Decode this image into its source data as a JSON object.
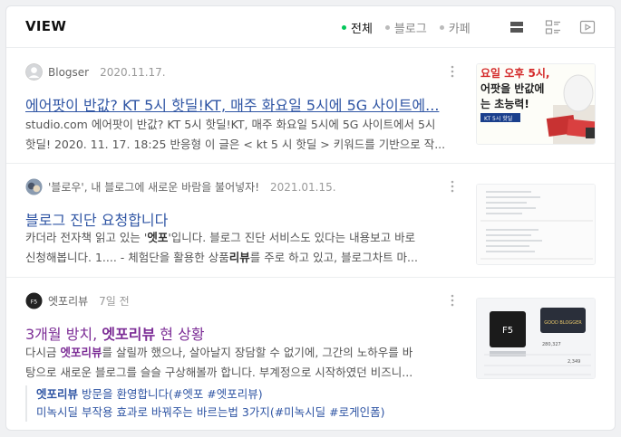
{
  "header": {
    "title": "VIEW",
    "tabs": [
      {
        "label": "전체",
        "active": true
      },
      {
        "label": "블로그",
        "active": false
      },
      {
        "label": "카페",
        "active": false
      }
    ]
  },
  "results": [
    {
      "source": "Blogser",
      "date": "2020.11.17.",
      "title": "에어팟이 반값? KT 5시 핫딜!KT, 매주 화요일 5시에 5G 사이트에...",
      "desc_line1": "studio.com 에어팟이 반값? KT 5시 핫딜!KT, 매주 화요일 5시에 5G 사이트에서 5시",
      "desc_line2": "핫딜! 2020. 11. 17. 18:25 반응형 이 글은 < kt 5 시 핫딜 > 키워드를 기반으로 작...",
      "thumb": {
        "line1": "요일 오후 5시,",
        "line2": "어팟을 반값에",
        "line3": "는 초능력!",
        "badge": "KT 5시 핫딜"
      }
    },
    {
      "source": "'블로우', 내 블로그에 새로운 바람을 불어넣자!",
      "date": "2021.01.15.",
      "title": "블로그 진단 요청합니다",
      "desc_line1_pre": "카더라 전자책 읽고 있는 '",
      "desc_line1_hl": "엣포",
      "desc_line1_post": "'입니다. 블로그 진단 서비스도 있다는 내용보고 바로",
      "desc_line2_pre": "신청해봅니다. 1.... - 체험단을 활용한 상품",
      "desc_line2_hl": "리뷰",
      "desc_line2_post": "를 주로 하고 있고, 블로그차트 마..."
    },
    {
      "source": "엣포리뷰",
      "date": "7일 전",
      "title_pre": "3개월 방치, ",
      "title_hl": "엣포리뷰",
      "title_post": " 현 상황",
      "desc_line1_pre": "다시금 ",
      "desc_line1_hl": "엣포리뷰",
      "desc_line1_post": "를 살릴까 했으나, 살아날지 장담할 수 없기에, 그간의 노하우를 바",
      "desc_line2": "탕으로 새로운 블로그를 슬슬 구상해볼까 합니다. 부계정으로 시작하였던 비즈니...",
      "related": [
        {
          "bold": "엣포리뷰",
          "text": " 방문을 환영합니다(#엣포 #엣포리뷰)"
        },
        {
          "bold": "",
          "text": "미녹시딜 부작용 효과로 바꿔주는 바르는법 3가지(#미녹시딜 #로게인폼)"
        }
      ],
      "thumb": {
        "tile": "F5",
        "label": "GOOD BLOGGER",
        "stat1": "280,327",
        "stat2": "2,349"
      }
    }
  ],
  "colors": {
    "accent": "#03c75a",
    "link": "#2f55a4",
    "visited": "#7c2d96"
  }
}
